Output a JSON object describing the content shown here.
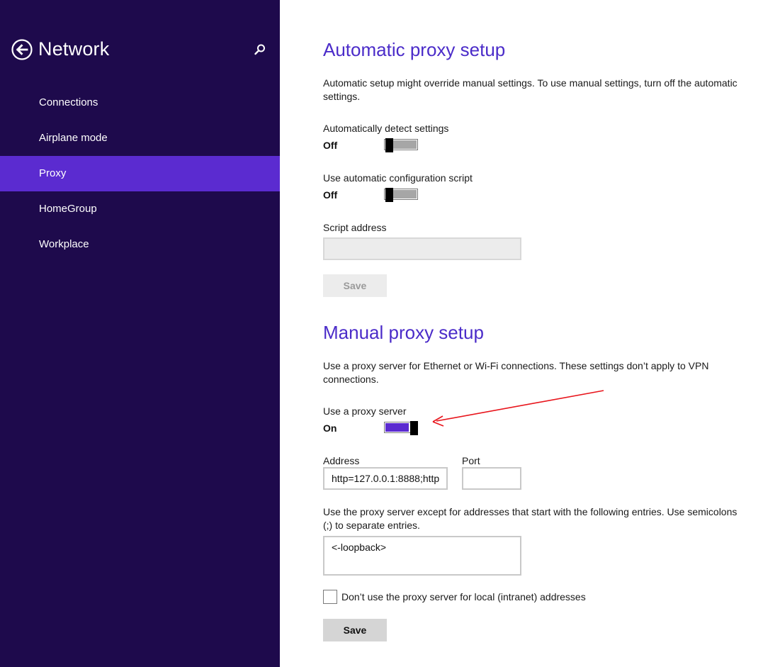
{
  "sidebar": {
    "title": "Network",
    "items": [
      {
        "label": "Connections"
      },
      {
        "label": "Airplane mode"
      },
      {
        "label": "Proxy"
      },
      {
        "label": "HomeGroup"
      },
      {
        "label": "Workplace"
      }
    ],
    "active_index": 2,
    "icons": {
      "back": "back-arrow-circle-icon",
      "search": "search-icon"
    }
  },
  "auto": {
    "title": "Automatic proxy setup",
    "description": "Automatic setup might override manual settings. To use manual settings, turn off the automatic settings.",
    "detect": {
      "label": "Automatically detect settings",
      "state": "Off"
    },
    "script": {
      "label": "Use automatic configuration script",
      "state": "Off"
    },
    "script_address": {
      "label": "Script address",
      "value": ""
    },
    "save_label": "Save"
  },
  "manual": {
    "title": "Manual proxy setup",
    "description": "Use a proxy server for Ethernet or Wi-Fi connections. These settings don’t apply to VPN connections.",
    "use_proxy": {
      "label": "Use a proxy server",
      "state": "On"
    },
    "address": {
      "label": "Address",
      "value": "http=127.0.0.1:8888;http"
    },
    "port": {
      "label": "Port",
      "value": ""
    },
    "exceptions": {
      "description": "Use the proxy server except for addresses that start with the following entries. Use semicolons (;) to separate entries.",
      "value": "<-loopback>"
    },
    "local_bypass": {
      "label": "Don’t use the proxy server for local (intranet) addresses",
      "checked": false
    },
    "save_label": "Save"
  },
  "colors": {
    "sidebar_bg": "#1e0a4c",
    "active_item": "#5b2bd0",
    "heading": "#4b2cc9",
    "annotation_arrow": "#e8141b"
  }
}
